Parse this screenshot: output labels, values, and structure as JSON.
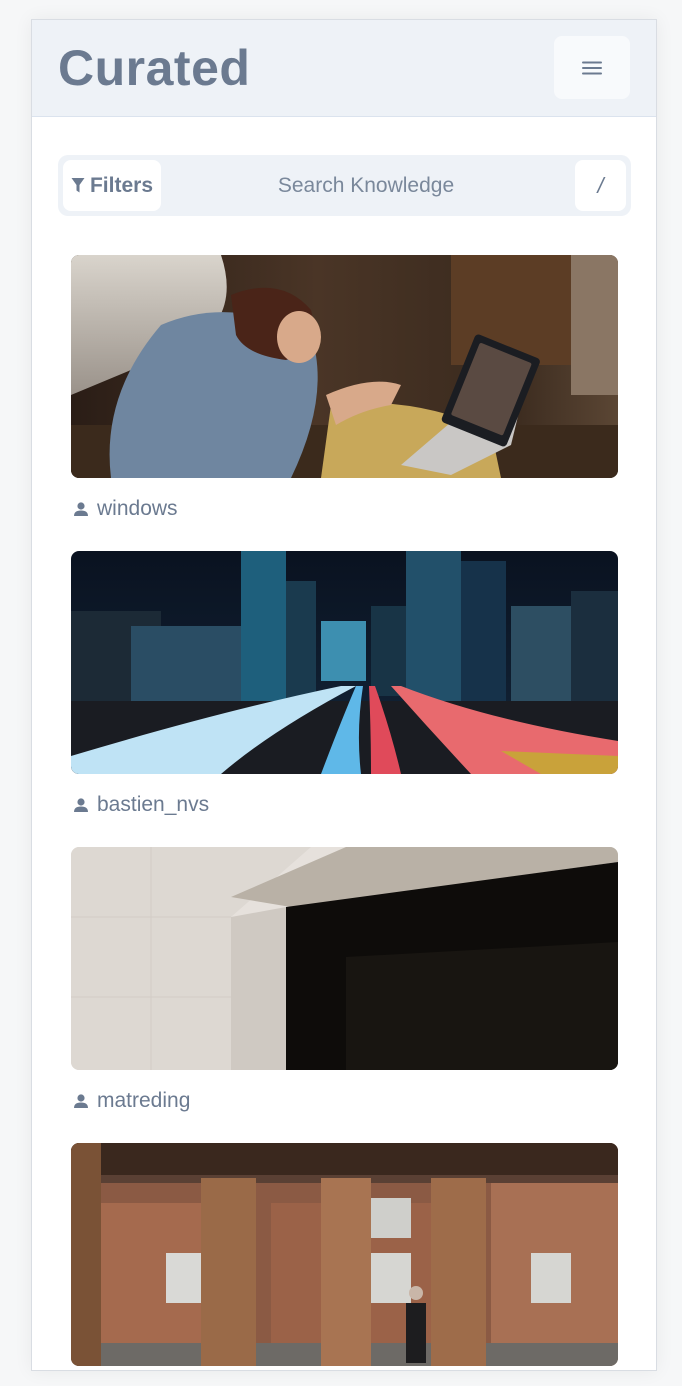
{
  "app": {
    "logo": "Curated",
    "menu_icon": "hamburger-menu-icon"
  },
  "search": {
    "filters_label": "Filters",
    "filter_icon": "funnel-icon",
    "placeholder": "Search Knowledge",
    "value": "",
    "shortcut_key": "/"
  },
  "photos": [
    {
      "author": "windows",
      "scene": "woman on video call with laptop"
    },
    {
      "author": "bastien_nvs",
      "scene": "night city highway light trails"
    },
    {
      "author": "matreding",
      "scene": "minimal architecture shadow"
    },
    {
      "author": "",
      "scene": "man walking past columns and brick building"
    }
  ],
  "colors": {
    "header_bg": "#eef2f7",
    "text_muted": "#6b7a90"
  }
}
